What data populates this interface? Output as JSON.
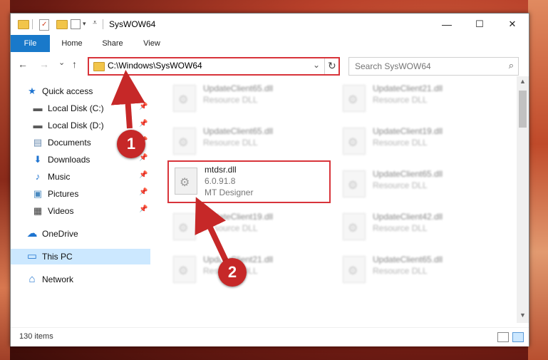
{
  "window": {
    "title": "SysWOW64",
    "minimize": "—",
    "maximize": "☐",
    "close": "✕"
  },
  "ribbon": {
    "tabs": [
      "File",
      "Home",
      "Share",
      "View"
    ]
  },
  "nav": {
    "back": "←",
    "forward": "→",
    "recent": "⌄",
    "up": "↑",
    "address": "C:\\Windows\\SysWOW64",
    "dropdown": "⌄",
    "refresh": "↻",
    "search_placeholder": "Search SysWOW64",
    "search_icon": "⌕"
  },
  "sidebar": {
    "items": [
      {
        "label": "Quick access",
        "icon": "star-icon",
        "glyph": "★",
        "color": "#1e74d0",
        "pinned": false
      },
      {
        "label": "Local Disk (C:)",
        "icon": "drive-icon",
        "glyph": "▬",
        "color": "#5a5a5a",
        "pinned": true
      },
      {
        "label": "Local Disk (D:)",
        "icon": "drive-icon",
        "glyph": "▬",
        "color": "#5a5a5a",
        "pinned": true
      },
      {
        "label": "Documents",
        "icon": "documents-icon",
        "glyph": "▤",
        "color": "#6a8bb0",
        "pinned": true
      },
      {
        "label": "Downloads",
        "icon": "download-icon",
        "glyph": "⬇",
        "color": "#1e74d0",
        "pinned": true
      },
      {
        "label": "Music",
        "icon": "music-icon",
        "glyph": "♪",
        "color": "#1e74d0",
        "pinned": true
      },
      {
        "label": "Pictures",
        "icon": "pictures-icon",
        "glyph": "▣",
        "color": "#4a8ac0",
        "pinned": true
      },
      {
        "label": "Videos",
        "icon": "video-icon",
        "glyph": "▦",
        "color": "#333",
        "pinned": true
      },
      {
        "label": "OneDrive",
        "icon": "cloud-icon",
        "glyph": "☁",
        "color": "#1e74d0",
        "pinned": false
      },
      {
        "label": "This PC",
        "icon": "computer-icon",
        "glyph": "▭",
        "color": "#2a7ad0",
        "pinned": false
      },
      {
        "label": "Network",
        "icon": "network-icon",
        "glyph": "⌂",
        "color": "#2a7ad0",
        "pinned": false
      }
    ],
    "pin_glyph": "📌"
  },
  "files": [
    {
      "name": "UpdateClient65.dll",
      "type": "Resource DLL"
    },
    {
      "name": "UpdateClient21.dll",
      "type": "Resource DLL"
    },
    {
      "name": "UpdateClient65.dll",
      "type": "Resource DLL"
    },
    {
      "name": "UpdateClient19.dll",
      "type": "Resource DLL"
    },
    {
      "name": "mtdsr.dll",
      "version": "6.0.91.8",
      "company": "MT Designer"
    },
    {
      "name": "UpdateClient65.dll",
      "type": "Resource DLL"
    },
    {
      "name": "UpdateClient19.dll",
      "type": "Resource DLL"
    },
    {
      "name": "UpdateClient42.dll",
      "type": "Resource DLL"
    },
    {
      "name": "UpdateClient21.dll",
      "type": "Resource DLL"
    },
    {
      "name": "UpdateClient65.dll",
      "type": "Resource DLL"
    }
  ],
  "status": {
    "item_count": "130 items"
  },
  "callouts": [
    "1",
    "2"
  ],
  "colors": {
    "highlight": "#d8343a",
    "accent": "#1979ca",
    "badge": "#c62828"
  }
}
